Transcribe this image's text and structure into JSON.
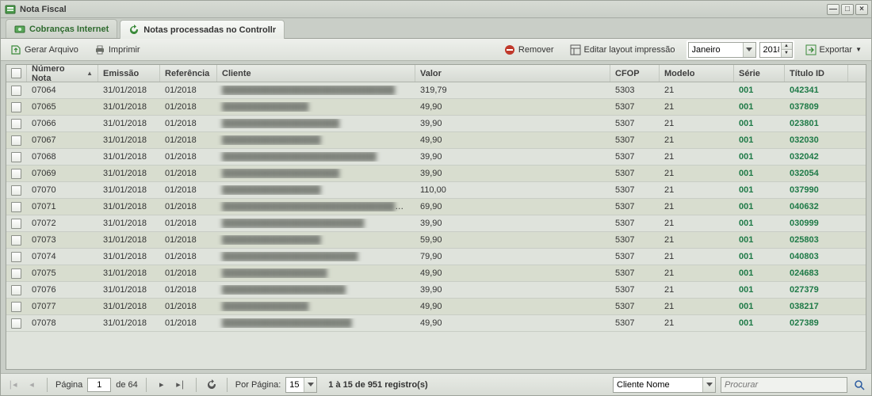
{
  "window": {
    "title": "Nota Fiscal"
  },
  "tabs": [
    {
      "label": "Cobranças Internet",
      "active": false
    },
    {
      "label": "Notas processadas no Controllr",
      "active": true
    }
  ],
  "toolbar": {
    "gerar": "Gerar Arquivo",
    "imprimir": "Imprimir",
    "remover": "Remover",
    "editar_layout": "Editar layout impressão",
    "month": "Janeiro",
    "year": "2018",
    "exportar": "Exportar"
  },
  "columns": {
    "numero": "Número Nota",
    "emissao": "Emissão",
    "referencia": "Referência",
    "cliente": "Cliente",
    "valor": "Valor",
    "cfop": "CFOP",
    "modelo": "Modelo",
    "serie": "Série",
    "titulo": "Título ID"
  },
  "rows": [
    {
      "numero": "07064",
      "emissao": "31/01/2018",
      "ref": "01/2018",
      "cliente": "████████████████████████████",
      "valor": "319,79",
      "cfop": "5303",
      "modelo": "21",
      "serie": "001",
      "titulo": "042341"
    },
    {
      "numero": "07065",
      "emissao": "31/01/2018",
      "ref": "01/2018",
      "cliente": "██████████████",
      "valor": "49,90",
      "cfop": "5307",
      "modelo": "21",
      "serie": "001",
      "titulo": "037809"
    },
    {
      "numero": "07066",
      "emissao": "31/01/2018",
      "ref": "01/2018",
      "cliente": "███████████████████",
      "valor": "39,90",
      "cfop": "5307",
      "modelo": "21",
      "serie": "001",
      "titulo": "023801"
    },
    {
      "numero": "07067",
      "emissao": "31/01/2018",
      "ref": "01/2018",
      "cliente": "████████████████",
      "valor": "49,90",
      "cfop": "5307",
      "modelo": "21",
      "serie": "001",
      "titulo": "032030"
    },
    {
      "numero": "07068",
      "emissao": "31/01/2018",
      "ref": "01/2018",
      "cliente": "█████████████████████████",
      "valor": "39,90",
      "cfop": "5307",
      "modelo": "21",
      "serie": "001",
      "titulo": "032042"
    },
    {
      "numero": "07069",
      "emissao": "31/01/2018",
      "ref": "01/2018",
      "cliente": "███████████████████",
      "valor": "39,90",
      "cfop": "5307",
      "modelo": "21",
      "serie": "001",
      "titulo": "032054"
    },
    {
      "numero": "07070",
      "emissao": "31/01/2018",
      "ref": "01/2018",
      "cliente": "████████████████",
      "valor": "110,00",
      "cfop": "5307",
      "modelo": "21",
      "serie": "001",
      "titulo": "037990"
    },
    {
      "numero": "07071",
      "emissao": "31/01/2018",
      "ref": "01/2018",
      "cliente": "████████████████████████████████",
      "valor": "69,90",
      "cfop": "5307",
      "modelo": "21",
      "serie": "001",
      "titulo": "040632"
    },
    {
      "numero": "07072",
      "emissao": "31/01/2018",
      "ref": "01/2018",
      "cliente": "███████████████████████",
      "valor": "39,90",
      "cfop": "5307",
      "modelo": "21",
      "serie": "001",
      "titulo": "030999"
    },
    {
      "numero": "07073",
      "emissao": "31/01/2018",
      "ref": "01/2018",
      "cliente": "████████████████",
      "valor": "59,90",
      "cfop": "5307",
      "modelo": "21",
      "serie": "001",
      "titulo": "025803"
    },
    {
      "numero": "07074",
      "emissao": "31/01/2018",
      "ref": "01/2018",
      "cliente": "██████████████████████",
      "valor": "79,90",
      "cfop": "5307",
      "modelo": "21",
      "serie": "001",
      "titulo": "040803"
    },
    {
      "numero": "07075",
      "emissao": "31/01/2018",
      "ref": "01/2018",
      "cliente": "█████████████████",
      "valor": "49,90",
      "cfop": "5307",
      "modelo": "21",
      "serie": "001",
      "titulo": "024683"
    },
    {
      "numero": "07076",
      "emissao": "31/01/2018",
      "ref": "01/2018",
      "cliente": "████████████████████",
      "valor": "39,90",
      "cfop": "5307",
      "modelo": "21",
      "serie": "001",
      "titulo": "027379"
    },
    {
      "numero": "07077",
      "emissao": "31/01/2018",
      "ref": "01/2018",
      "cliente": "██████████████",
      "valor": "49,90",
      "cfop": "5307",
      "modelo": "21",
      "serie": "001",
      "titulo": "038217"
    },
    {
      "numero": "07078",
      "emissao": "31/01/2018",
      "ref": "01/2018",
      "cliente": "█████████████████████",
      "valor": "49,90",
      "cfop": "5307",
      "modelo": "21",
      "serie": "001",
      "titulo": "027389"
    }
  ],
  "pager": {
    "page_label": "Página",
    "page": "1",
    "of": "de 64",
    "per_page_label": "Por Página:",
    "per_page": "15",
    "summary": "1 à 15 de 951 registro(s)",
    "search_by": "Cliente Nome",
    "search_placeholder": "Procurar"
  }
}
